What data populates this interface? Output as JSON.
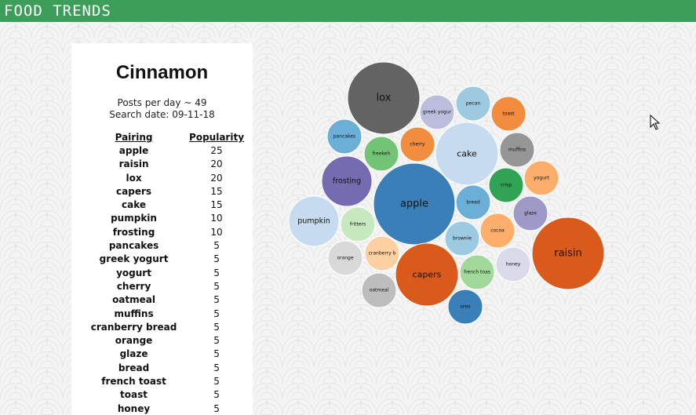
{
  "header": {
    "title": "FOOD TRENDS"
  },
  "colors": {
    "header": "#3d9e5a"
  },
  "panel": {
    "ingredient": "Cinnamon",
    "posts_line": "Posts per day ~ 49",
    "date_line": "Search date: 09-11-18",
    "table_headers": [
      "Pairing",
      "Popularity"
    ],
    "rows": [
      {
        "name": "apple",
        "value": "25"
      },
      {
        "name": "raisin",
        "value": "20"
      },
      {
        "name": "lox",
        "value": "20"
      },
      {
        "name": "capers",
        "value": "15"
      },
      {
        "name": "cake",
        "value": "15"
      },
      {
        "name": "pumpkin",
        "value": "10"
      },
      {
        "name": "frosting",
        "value": "10"
      },
      {
        "name": "pancakes",
        "value": "5"
      },
      {
        "name": "greek yogurt",
        "value": "5"
      },
      {
        "name": "yogurt",
        "value": "5"
      },
      {
        "name": "cherry",
        "value": "5"
      },
      {
        "name": "oatmeal",
        "value": "5"
      },
      {
        "name": "muffins",
        "value": "5"
      },
      {
        "name": "cranberry bread",
        "value": "5"
      },
      {
        "name": "orange",
        "value": "5"
      },
      {
        "name": "glaze",
        "value": "5"
      },
      {
        "name": "bread",
        "value": "5"
      },
      {
        "name": "french toast",
        "value": "5"
      },
      {
        "name": "toast",
        "value": "5"
      },
      {
        "name": "honey",
        "value": "5"
      }
    ]
  },
  "chart_data": {
    "type": "bubble",
    "title": "",
    "bubbles": [
      {
        "label": "apple",
        "value": 25,
        "color": "#3a7fb8"
      },
      {
        "label": "raisin",
        "value": 20,
        "color": "#d95a1a"
      },
      {
        "label": "lox",
        "value": 20,
        "color": "#636363"
      },
      {
        "label": "capers",
        "value": 15,
        "color": "#d95a1a"
      },
      {
        "label": "cake",
        "value": 15,
        "color": "#c6dbef"
      },
      {
        "label": "pumpkin",
        "value": 10,
        "color": "#c6dbef"
      },
      {
        "label": "frosting",
        "value": 10,
        "color": "#756bb1"
      },
      {
        "label": "pancakes",
        "value": 5,
        "color": "#6baed6"
      },
      {
        "label": "greek yogur",
        "value": 5,
        "color": "#bcbddc"
      },
      {
        "label": "pecan",
        "value": 5,
        "color": "#9ecae1"
      },
      {
        "label": "toast",
        "value": 5,
        "color": "#f28c3f"
      },
      {
        "label": "cherry",
        "value": 5,
        "color": "#f28c3f"
      },
      {
        "label": "freekeh",
        "value": 5,
        "color": "#74c476"
      },
      {
        "label": "muffins",
        "value": 5,
        "color": "#969696"
      },
      {
        "label": "yogurt",
        "value": 5,
        "color": "#fdae6b"
      },
      {
        "label": "crisp",
        "value": 5,
        "color": "#31a354"
      },
      {
        "label": "bread",
        "value": 5,
        "color": "#6baed6"
      },
      {
        "label": "glaze",
        "value": 5,
        "color": "#9e9ac8"
      },
      {
        "label": "fritters",
        "value": 5,
        "color": "#c7e9c0"
      },
      {
        "label": "cocoa",
        "value": 5,
        "color": "#fdae6b"
      },
      {
        "label": "brownie",
        "value": 5,
        "color": "#9ecae1"
      },
      {
        "label": "orange",
        "value": 5,
        "color": "#d9d9d9"
      },
      {
        "label": "cranberry b",
        "value": 5,
        "color": "#fdd0a2"
      },
      {
        "label": "french toas",
        "value": 5,
        "color": "#a1d99b"
      },
      {
        "label": "honey",
        "value": 5,
        "color": "#dadaeb"
      },
      {
        "label": "oatmeal",
        "value": 5,
        "color": "#bdbdbd"
      },
      {
        "label": "oreo",
        "value": 5,
        "color": "#3a7fb8"
      }
    ]
  }
}
